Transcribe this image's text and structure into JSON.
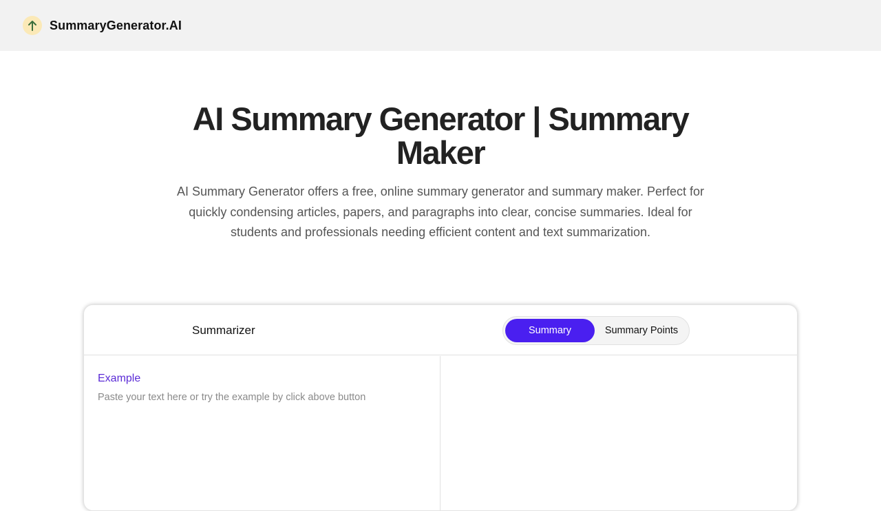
{
  "header": {
    "brand": "SummaryGenerator.AI",
    "logo_icon": "upload-arrow-icon",
    "background": "#f2f2f2"
  },
  "hero": {
    "title": "AI Summary Generator | Summary Maker",
    "description": "AI Summary Generator offers a free, online summary generator and summary maker. Perfect for quickly condensing articles, papers, and paragraphs into clear, concise summaries. Ideal for students and professionals needing efficient content and text summarization."
  },
  "summarizer": {
    "title": "Summarizer",
    "modes": [
      "Summary",
      "Summary Points"
    ],
    "active_mode": "Summary",
    "accent_color": "#4a1ff0",
    "example_label": "Example",
    "input_value": "",
    "input_placeholder": "Paste your text here or try the example by click above button"
  }
}
